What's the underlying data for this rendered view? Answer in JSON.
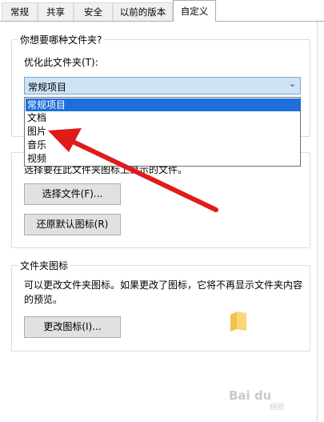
{
  "tabs": [
    "常规",
    "共享",
    "安全",
    "以前的版本",
    "自定义"
  ],
  "group_folder_type": {
    "title": "你想要哪种文件夹?",
    "optimize_label": "优化此文件夹(T):",
    "selected": "常规项目",
    "options": [
      "常规项目",
      "文档",
      "图片",
      "音乐",
      "视频"
    ]
  },
  "group_folder_picture": {
    "description_partial": "选择要在此文件夹图标上显示的文件。",
    "choose_file_button": "选择文件(F)...",
    "restore_default_button": "还原默认图标(R)"
  },
  "group_folder_icon": {
    "title": "文件夹图标",
    "description": "可以更改文件夹图标。如果更改了图标，它将不再显示文件夹内容的预览。",
    "change_icon_button": "更改图标(I)..."
  },
  "watermark": {
    "main": "Bai du",
    "sub": "经验"
  },
  "colors": {
    "accent_arrow": "#e01b1b",
    "selection": "#1e6fd9",
    "combo_bg": "#cde4f7"
  }
}
